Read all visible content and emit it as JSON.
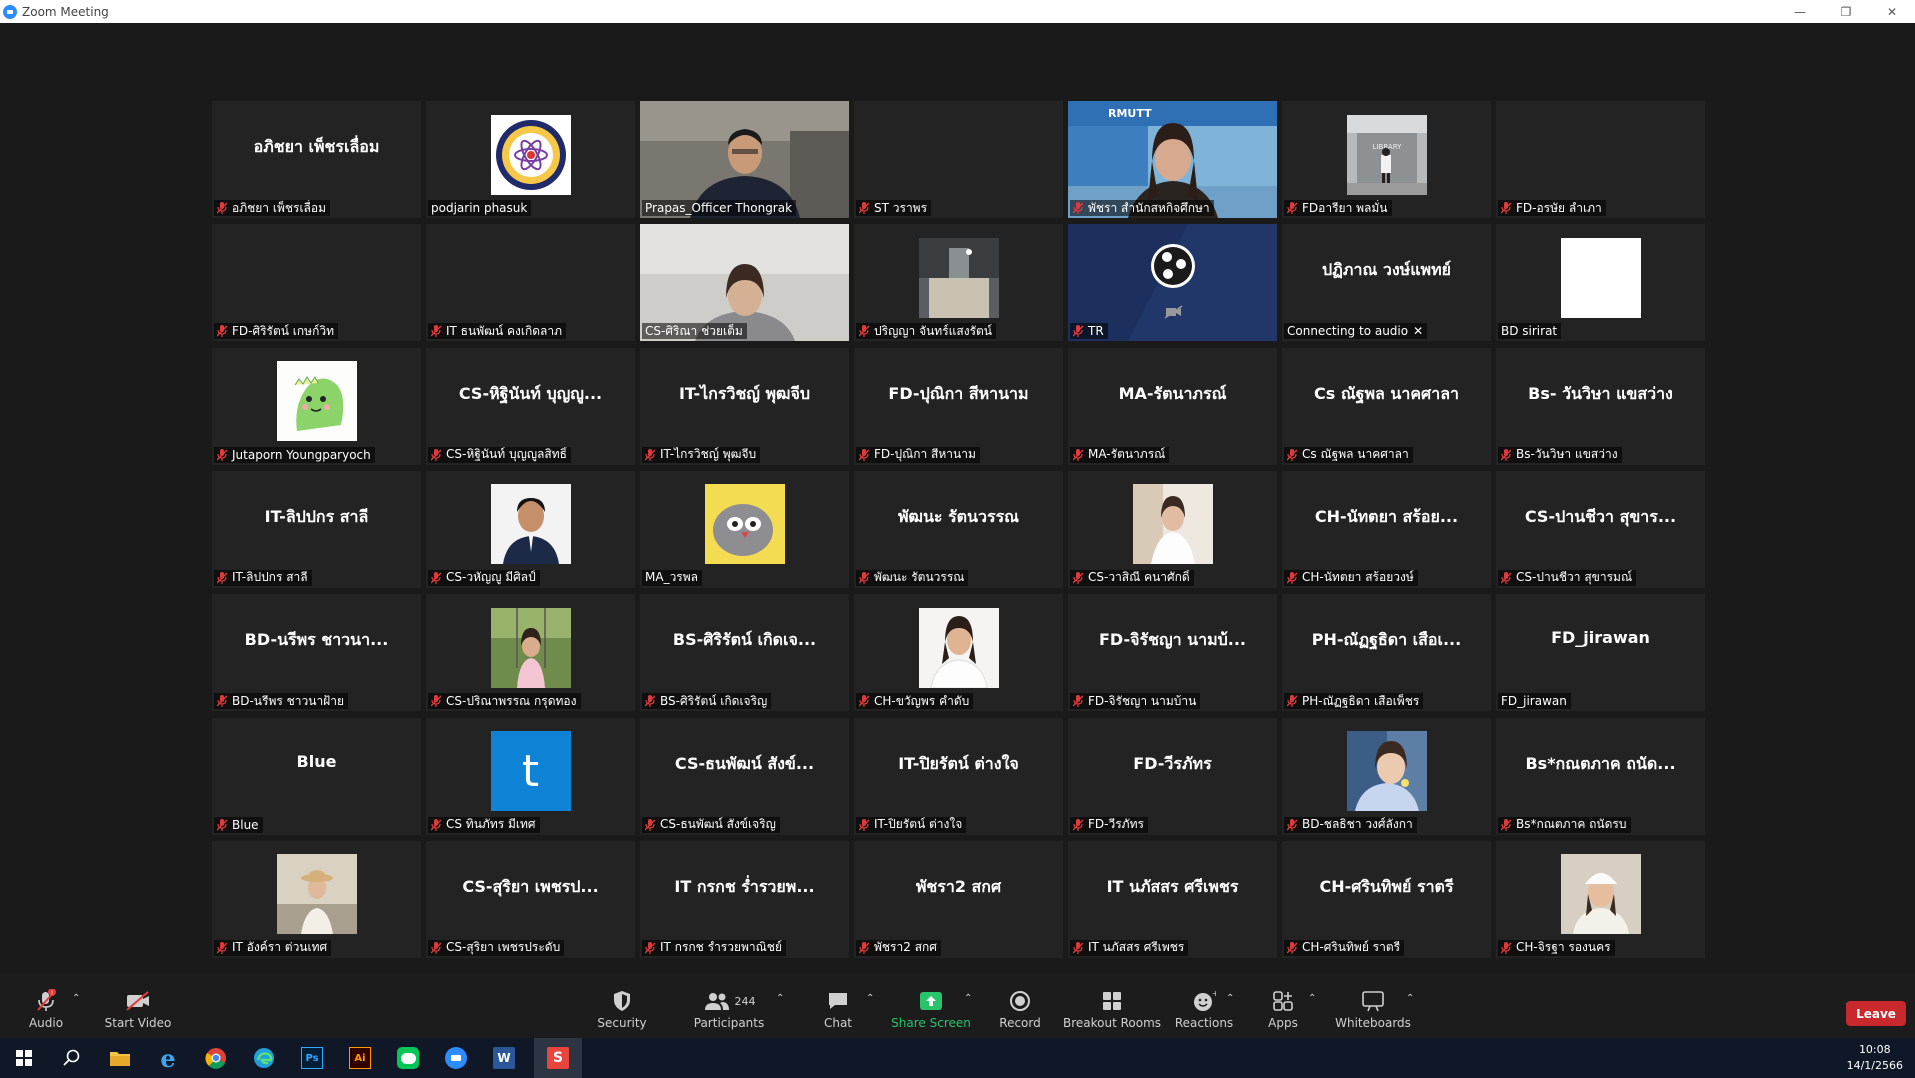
{
  "window": {
    "title": "Zoom Meeting"
  },
  "tiles": [
    {
      "big": "อภิชยา เพ็ชรเลื่อม",
      "label": "อภิชยา เพ็ชรเลื่อม",
      "muted": true,
      "kind": "name"
    },
    {
      "big": "",
      "label": "podjarin phasuk",
      "muted": false,
      "kind": "logo"
    },
    {
      "big": "",
      "label": "Prapas_Officer Thongrak",
      "muted": false,
      "kind": "video-man",
      "active": true
    },
    {
      "big": "",
      "label": "ST วราพร",
      "muted": true,
      "kind": "blank"
    },
    {
      "big": "",
      "label": "พัชรา  สำนักสหกิจศึกษา",
      "muted": true,
      "kind": "video-woman"
    },
    {
      "big": "",
      "label": "FDอารียา พลมั่น",
      "muted": true,
      "kind": "photo-library"
    },
    {
      "big": "",
      "label": "FD-อรษัย ลำเภา",
      "muted": true,
      "kind": "blank"
    },
    {
      "big": "",
      "label": "FD-ศิริรัตน์ เกษก์วิท",
      "muted": true,
      "kind": "blank"
    },
    {
      "big": "",
      "label": "IT ธนพัฒน์ คงเกิดลาภ",
      "muted": true,
      "kind": "blank"
    },
    {
      "big": "",
      "label": "CS-ศิริณา ช่วยเต็ม",
      "muted": false,
      "kind": "video-girl"
    },
    {
      "big": "",
      "label": "ปริญญา จันทร์แสงรัตน์",
      "muted": true,
      "kind": "photo-ceiling"
    },
    {
      "big": "",
      "label": "TR",
      "muted": true,
      "kind": "obs"
    },
    {
      "big": "ปฏิภาณ วงษ์แพทย์",
      "label": "Connecting to audio",
      "muted": false,
      "kind": "name",
      "connecting": true
    },
    {
      "big": "",
      "label": "BD sirirat",
      "muted": false,
      "kind": "white"
    },
    {
      "big": "",
      "label": "Jutaporn Youngparyoch",
      "muted": true,
      "kind": "photo-dino"
    },
    {
      "big": "CS-หิฐินันท์ บุญญู...",
      "label": "CS-หิฐินันท์ บุญญูลสิทธิ์",
      "muted": true,
      "kind": "name"
    },
    {
      "big": "IT-ไกรวิชญ์ พุฒจีบ",
      "label": "IT-ไกรวิชญ์ พุฒจีบ",
      "muted": true,
      "kind": "name"
    },
    {
      "big": "FD-ปุณิกา สีหานาม",
      "label": "FD-ปุณิกา สีหานาม",
      "muted": true,
      "kind": "name"
    },
    {
      "big": "MA-รัตนาภรณ์",
      "label": "MA-รัตนาภรณ์",
      "muted": true,
      "kind": "name"
    },
    {
      "big": "Cs ณัฐพล นาคศาลา",
      "label": "Cs ณัฐพล นาคศาลา",
      "muted": true,
      "kind": "name"
    },
    {
      "big": "Bs- วันวิษา แขสว่าง",
      "label": "Bs-วันวิษา แขสว่าง",
      "muted": true,
      "kind": "name"
    },
    {
      "big": "IT-ลิปปกร สาลี",
      "label": "IT-ลิปปกร สาลี",
      "muted": true,
      "kind": "name"
    },
    {
      "big": "",
      "label": "CS-วหัญญู มีศิลป์",
      "muted": true,
      "kind": "photo-boy"
    },
    {
      "big": "",
      "label": "MA_วรพล",
      "muted": false,
      "kind": "photo-bird"
    },
    {
      "big": "พัฒนะ รัตนวรรณ",
      "label": "พัฒนะ รัตนวรรณ",
      "muted": true,
      "kind": "name"
    },
    {
      "big": "",
      "label": "CS-วาสิณี คนาศักดิ์",
      "muted": true,
      "kind": "photo-bride"
    },
    {
      "big": "CH-นัทตยา สร้อย...",
      "label": "CH-นัทตยา สร้อยวงษ์",
      "muted": true,
      "kind": "name"
    },
    {
      "big": "CS-ปานชีวา สุขาร...",
      "label": "CS-ปานชีวา สุขารมณ์",
      "muted": true,
      "kind": "name"
    },
    {
      "big": "BD-นรีพร ชาวนา...",
      "label": "BD-นรีพร ชาวนาฝ้าย",
      "muted": true,
      "kind": "name"
    },
    {
      "big": "",
      "label": "CS-ปริณาพรรณ กรุดทอง",
      "muted": true,
      "kind": "photo-swing"
    },
    {
      "big": "BS-ศิริรัตน์ เกิดเจ...",
      "label": "BS-ศิริรัตน์ เกิดเจริญ",
      "muted": true,
      "kind": "name"
    },
    {
      "big": "",
      "label": "CH-ขวัญพร คำดับ",
      "muted": true,
      "kind": "photo-student"
    },
    {
      "big": "FD-จิรัชญา นามบ้...",
      "label": "FD-จิรัชญา นามบ้าน",
      "muted": true,
      "kind": "name"
    },
    {
      "big": "PH-ณัฏฐธิดา เสือเ...",
      "label": "PH-ณัฏฐธิดา เสือเพ็ชร",
      "muted": true,
      "kind": "name"
    },
    {
      "big": "FD_jirawan",
      "label": "FD_jirawan",
      "muted": false,
      "kind": "name"
    },
    {
      "big": "Blue",
      "label": "Blue",
      "muted": true,
      "kind": "name"
    },
    {
      "big": "",
      "label": "CS ทินภัทร มีเทศ",
      "muted": true,
      "kind": "t-avatar"
    },
    {
      "big": "CS-ธนพัฒน์ สังข์...",
      "label": "CS-ธนพัฒน์ สังข์เจริญ",
      "muted": true,
      "kind": "name"
    },
    {
      "big": "IT-ปิยรัตน์ ต่างใจ",
      "label": "IT-ปิยรัตน์ ต่างใจ",
      "muted": true,
      "kind": "name"
    },
    {
      "big": "FD-วีรภัทร",
      "label": "FD-วีรภัทร",
      "muted": true,
      "kind": "name"
    },
    {
      "big": "",
      "label": "BD-ชลธิชา วงศ์ลังกา",
      "muted": true,
      "kind": "photo-selfie"
    },
    {
      "big": "Bs*กณตภาค ถนัด...",
      "label": "Bs*กณตภาค ถนัดรบ",
      "muted": true,
      "kind": "name"
    },
    {
      "big": "",
      "label": "IT อังค์รา ต่วนเทศ",
      "muted": true,
      "kind": "photo-hat"
    },
    {
      "big": "CS-สุริยา เพชรป...",
      "label": "CS-สุริยา  เพชรประดับ",
      "muted": true,
      "kind": "name"
    },
    {
      "big": "IT กรกช ร่ำรวยพ...",
      "label": "IT กรกช ร่ำรวยพาณิชย์",
      "muted": true,
      "kind": "name"
    },
    {
      "big": "พัชรา2 สกศ",
      "label": "พัชรา2 สกศ",
      "muted": true,
      "kind": "name"
    },
    {
      "big": "IT นภัสสร ศรีเพชร",
      "label": "IT นภัสสร ศรีเพชร",
      "muted": true,
      "kind": "name"
    },
    {
      "big": "CH-ศรินทิพย์ ราตรี",
      "label": "CH-ศรินทิพย์ ราตรี",
      "muted": true,
      "kind": "name"
    },
    {
      "big": "",
      "label": "CH-จิรฐา รองนคร",
      "muted": true,
      "kind": "photo-cap"
    }
  ],
  "toolbar": {
    "audio": "Audio",
    "start_video": "Start Video",
    "security": "Security",
    "participants": "Participants",
    "participants_count": "244",
    "chat": "Chat",
    "share_screen": "Share Screen",
    "record": "Record",
    "breakout": "Breakout Rooms",
    "reactions": "Reactions",
    "apps": "Apps",
    "whiteboards": "Whiteboards",
    "leave": "Leave"
  },
  "clock": {
    "time": "10:08",
    "date": "14/1/2566"
  },
  "colors": {
    "active_speaker": "#c6e35f",
    "share_green": "#29c36a",
    "leave_red": "#c9282d",
    "muted_red": "#e03b3b"
  }
}
